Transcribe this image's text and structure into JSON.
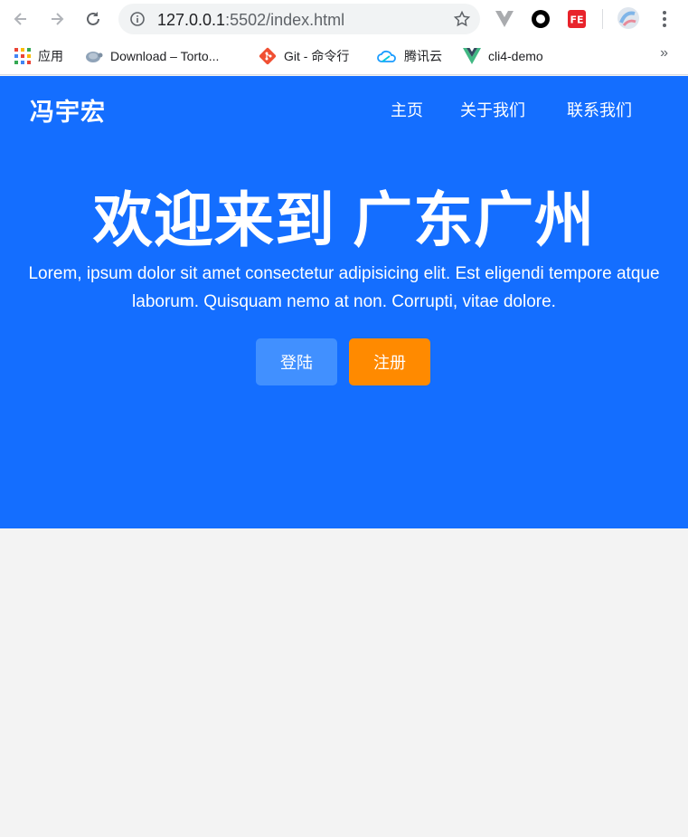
{
  "browser": {
    "url_host": "127.0.0.1",
    "url_rest": ":5502/index.html",
    "bookmarks": [
      {
        "label": "应用",
        "icon": "apps-grid-icon"
      },
      {
        "label": "Download – Torto...",
        "icon": "tortoise-icon"
      },
      {
        "label": "Git - 命令行",
        "icon": "git-icon"
      },
      {
        "label": "腾讯云",
        "icon": "cloud-icon"
      },
      {
        "label": "cli4-demo",
        "icon": "vue-icon"
      }
    ],
    "more_label": "»",
    "extensions": [
      "vue-devtools-icon",
      "circle-extension-icon",
      "fe-extension-icon",
      "profile-avatar-icon",
      "menu-icon"
    ]
  },
  "page": {
    "brand": "冯宇宏",
    "nav": [
      "主页",
      "关于我们",
      "联系我们"
    ],
    "headline": "欢迎来到 广东广州",
    "lead": "Lorem, ipsum dolor sit amet consectetur adipisicing elit. Est eligendi tempore atque laborum. Quisquam nemo at non. Corrupti, vitae dolore.",
    "buttons": {
      "login": "登陆",
      "register": "注册"
    }
  },
  "colors": {
    "hero": "#146eff",
    "login_button": "#4190ff",
    "register_button": "#ff8a00",
    "page_background": "#f3f3f3"
  }
}
